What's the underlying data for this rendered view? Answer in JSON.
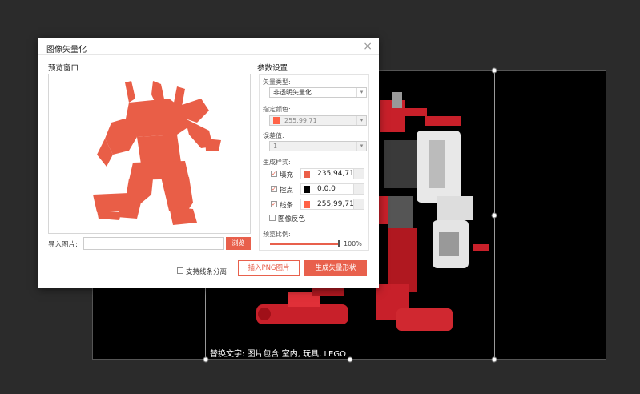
{
  "canvas": {
    "alt_text": "替换文字: 图片包含 室内, 玩具, LEGO"
  },
  "dialog": {
    "title": "图像矢量化",
    "close_glyph": "×",
    "preview": {
      "label": "预览窗口",
      "import_label": "导入图片:",
      "browse_label": "浏览"
    },
    "params": {
      "label": "参数设置",
      "vector_type_label": "矢量类型:",
      "vector_type_value": "非透明矢量化",
      "color_label": "指定颜色:",
      "color_value": "255,99,71",
      "tolerance_label": "误差值:",
      "tolerance_value": "1",
      "style_label": "生成样式:",
      "styles": [
        {
          "label": "填充",
          "value": "235,94,71",
          "color": "#eb5e47",
          "checked": true
        },
        {
          "label": "控点",
          "value": "0,0,0",
          "color": "#000000",
          "checked": true
        },
        {
          "label": "线条",
          "value": "255,99,71",
          "color": "#ff6347",
          "checked": true
        }
      ],
      "invert_label": "图像反色",
      "scale_label": "预览比例:",
      "scale_value": "100%",
      "scale_fraction": 1.0
    },
    "separate_lines_label": "支持线条分离",
    "insert_png_label": "插入PNG图片",
    "generate_label": "生成矢量形状",
    "accent_color": "#e8604c",
    "check_glyph": "✓",
    "arrow_glyph": "▾"
  }
}
